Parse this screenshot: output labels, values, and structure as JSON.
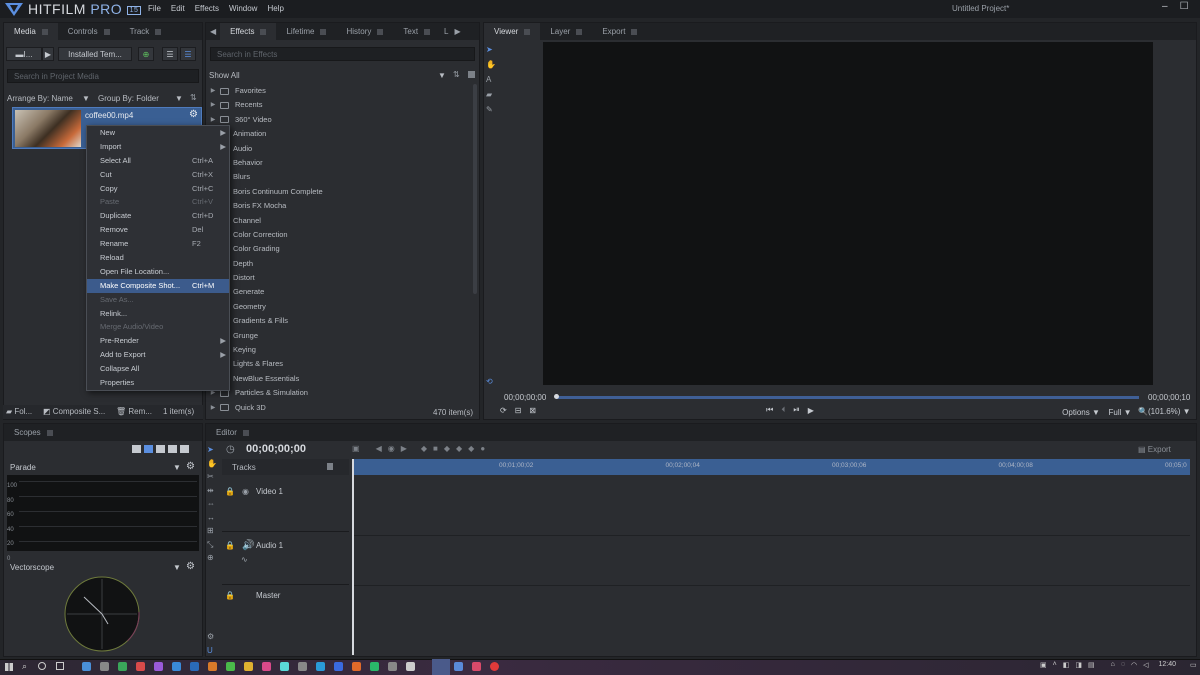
{
  "app": {
    "brand": "HITFILM",
    "brand_suffix": "PRO",
    "version_badge": "15",
    "window_title": "Untitled Project*"
  },
  "menu": [
    "File",
    "Edit",
    "Effects",
    "Window",
    "Help"
  ],
  "left_tabs": [
    "Media",
    "Controls",
    "Track"
  ],
  "media": {
    "import_label": "I...",
    "installed_label": "Installed Tem...",
    "search_placeholder": "Search in Project Media",
    "arrange_label": "Arrange By: Name",
    "group_label": "Group By: Folder",
    "file_name": "coffee00.mp4",
    "footer": {
      "folder": "Fol...",
      "composite": "Composite S...",
      "remove": "Rem...",
      "count": "1 item(s)"
    }
  },
  "context_menu": [
    {
      "label": "New",
      "shortcut": "",
      "arrow": true,
      "state": ""
    },
    {
      "label": "Import",
      "shortcut": "",
      "arrow": true,
      "state": ""
    },
    {
      "label": "Select All",
      "shortcut": "Ctrl+A",
      "arrow": false,
      "state": ""
    },
    {
      "label": "Cut",
      "shortcut": "Ctrl+X",
      "arrow": false,
      "state": ""
    },
    {
      "label": "Copy",
      "shortcut": "Ctrl+C",
      "arrow": false,
      "state": ""
    },
    {
      "label": "Paste",
      "shortcut": "Ctrl+V",
      "arrow": false,
      "state": "disabled"
    },
    {
      "label": "Duplicate",
      "shortcut": "Ctrl+D",
      "arrow": false,
      "state": ""
    },
    {
      "label": "Remove",
      "shortcut": "Del",
      "arrow": false,
      "state": ""
    },
    {
      "label": "Rename",
      "shortcut": "F2",
      "arrow": false,
      "state": ""
    },
    {
      "label": "Reload",
      "shortcut": "",
      "arrow": false,
      "state": ""
    },
    {
      "label": "Open File Location...",
      "shortcut": "",
      "arrow": false,
      "state": ""
    },
    {
      "label": "Make Composite Shot...",
      "shortcut": "Ctrl+M",
      "arrow": false,
      "state": "highlighted"
    },
    {
      "label": "Save As...",
      "shortcut": "",
      "arrow": false,
      "state": "disabled"
    },
    {
      "label": "Relink...",
      "shortcut": "",
      "arrow": false,
      "state": ""
    },
    {
      "label": "Merge Audio/Video",
      "shortcut": "",
      "arrow": false,
      "state": "disabled"
    },
    {
      "label": "Pre-Render",
      "shortcut": "",
      "arrow": true,
      "state": ""
    },
    {
      "label": "Add to Export",
      "shortcut": "",
      "arrow": true,
      "state": ""
    },
    {
      "label": "Collapse All",
      "shortcut": "",
      "arrow": false,
      "state": ""
    },
    {
      "label": "Properties",
      "shortcut": "",
      "arrow": false,
      "state": ""
    }
  ],
  "effects_tabs": [
    "Effects",
    "Lifetime",
    "History",
    "Text",
    "L"
  ],
  "effects": {
    "search_placeholder": "Search in Effects",
    "filter": "Show All",
    "count": "470 item(s)",
    "items": [
      {
        "label": "Favorites",
        "type": "folder"
      },
      {
        "label": "Recents",
        "type": "folder"
      },
      {
        "label": "360° Video",
        "type": "folder"
      },
      {
        "label": "Animation",
        "type": "sub"
      },
      {
        "label": "Audio",
        "type": "sub"
      },
      {
        "label": "Behavior",
        "type": "sub"
      },
      {
        "label": "Blurs",
        "type": "sub"
      },
      {
        "label": "Boris Continuum Complete",
        "type": "sub"
      },
      {
        "label": "Boris FX Mocha",
        "type": "sub"
      },
      {
        "label": "Channel",
        "type": "sub"
      },
      {
        "label": "Color Correction",
        "type": "sub"
      },
      {
        "label": "Color Grading",
        "type": "sub"
      },
      {
        "label": "Depth",
        "type": "sub"
      },
      {
        "label": "Distort",
        "type": "sub"
      },
      {
        "label": "Generate",
        "type": "sub"
      },
      {
        "label": "Geometry",
        "type": "sub"
      },
      {
        "label": "Gradients & Fills",
        "type": "sub"
      },
      {
        "label": "Grunge",
        "type": "sub"
      },
      {
        "label": "Keying",
        "type": "sub"
      },
      {
        "label": "Lights & Flares",
        "type": "sub"
      },
      {
        "label": "NewBlue Essentials",
        "type": "sub"
      },
      {
        "label": "Particles & Simulation",
        "type": "folder"
      },
      {
        "label": "Quick 3D",
        "type": "folder"
      }
    ]
  },
  "viewer_tabs": [
    "Viewer",
    "Layer",
    "Export"
  ],
  "viewer": {
    "time_start": "00;00;00;00",
    "time_end": "00;00;00;10",
    "options": "Options",
    "quality": "Full",
    "zoom": "(101.6%)"
  },
  "scopes": {
    "tab": "Scopes",
    "parade_label": "Parade",
    "parade_ticks": [
      "100",
      "80",
      "60",
      "40",
      "20",
      "0"
    ],
    "vectorscope_label": "Vectorscope"
  },
  "editor": {
    "tab": "Editor",
    "timecode": "00;00;00;00",
    "tracks_label": "Tracks",
    "export_label": "Export",
    "ruler": [
      "00;01;00;02",
      "00;02;00;04",
      "00;03;00;06",
      "00;04;00;08",
      "00;05;0"
    ],
    "tracks": [
      {
        "label": "Video 1"
      },
      {
        "label": "Audio 1"
      },
      {
        "label": "Master"
      }
    ]
  },
  "taskbar": {
    "clock": "12:40"
  },
  "colors": {
    "accent": "#3c5b8c",
    "bg": "#232528",
    "panel": "#2b2d31"
  }
}
